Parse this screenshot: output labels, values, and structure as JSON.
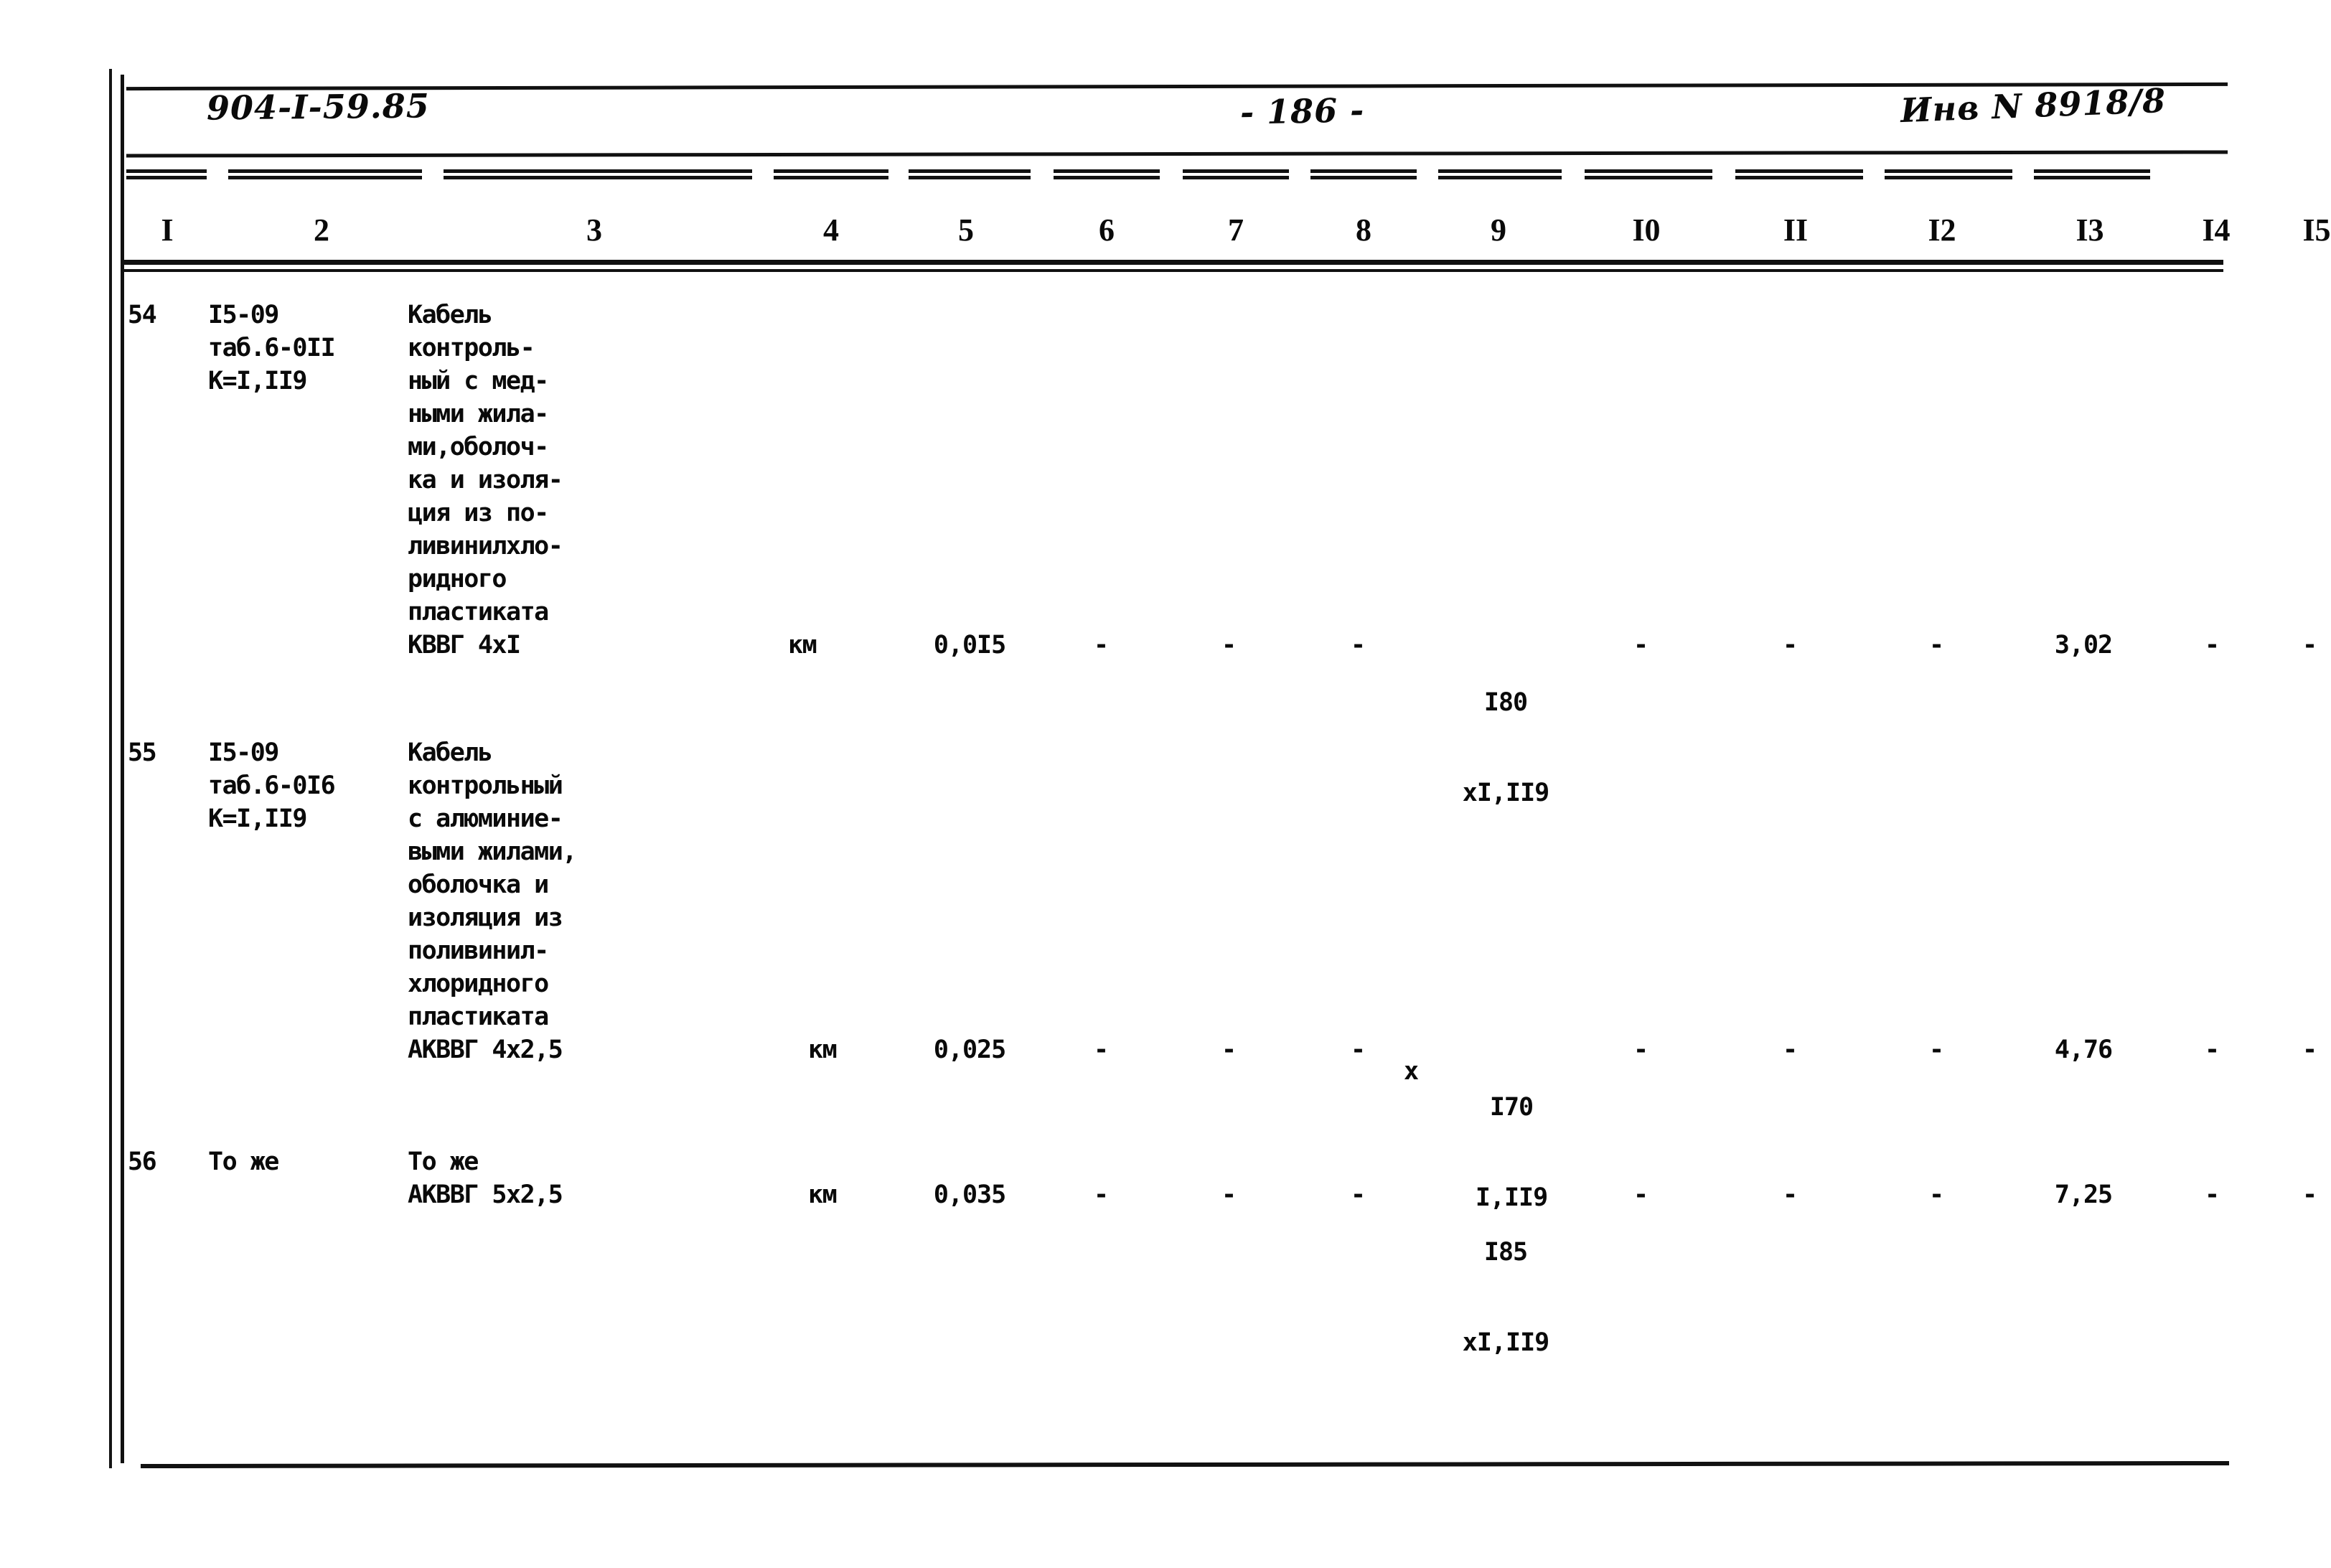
{
  "document": {
    "code": "904-I-59.85",
    "page_label": "- 186 -",
    "inventory": "Инв N 8918/8"
  },
  "table": {
    "column_numbers": [
      "I",
      "2",
      "3",
      "4",
      "5",
      "6",
      "7",
      "8",
      "9",
      "I0",
      "II",
      "I2",
      "I3",
      "I4",
      "I5"
    ],
    "rows": [
      {
        "num": "54",
        "code": "I5-09\nтаб.6-0II\nК=I,II9",
        "description": "Кабель\nконтроль-\nный с мед-\nными жила-\nми,оболоч-\nка и изоля-\nция из по-\nливинилхло-\nридного\nпластиката\nКВВГ 4xI",
        "unit": "км",
        "c5": "0,0I5",
        "c6": "-",
        "c7": "-",
        "c8": "-",
        "c9_top": "I80",
        "c9_bot": "xI,II9",
        "c10": "-",
        "c11": "-",
        "c12": "-",
        "c13": "3,02",
        "c14": "-",
        "c15": "-"
      },
      {
        "num": "55",
        "code": "I5-09\nтаб.6-0I6\nК=I,II9",
        "description": "Кабель\nконтрольный\nс алюминие-\nвыми жилами,\nоболочка и\nизоляция из\nполивинил-\nхлоридного\nпластиката\nАКВВГ 4x2,5",
        "unit": "км",
        "c5": "0,025",
        "c6": "-",
        "c7": "-",
        "c8": "-",
        "c9_top": "I70",
        "c9_bot": "I,II9",
        "c9_mult": "x",
        "c10": "-",
        "c11": "-",
        "c12": "-",
        "c13": "4,76",
        "c14": "-",
        "c15": "-"
      },
      {
        "num": "56",
        "code": "То же",
        "description": "То же\nАКВВГ 5x2,5",
        "unit": "км",
        "c5": "0,035",
        "c6": "-",
        "c7": "-",
        "c8": "-",
        "c9_top": "I85",
        "c9_bot": "xI,II9",
        "c10": "-",
        "c11": "-",
        "c12": "-",
        "c13": "7,25",
        "c14": "-",
        "c15": "-"
      }
    ]
  }
}
